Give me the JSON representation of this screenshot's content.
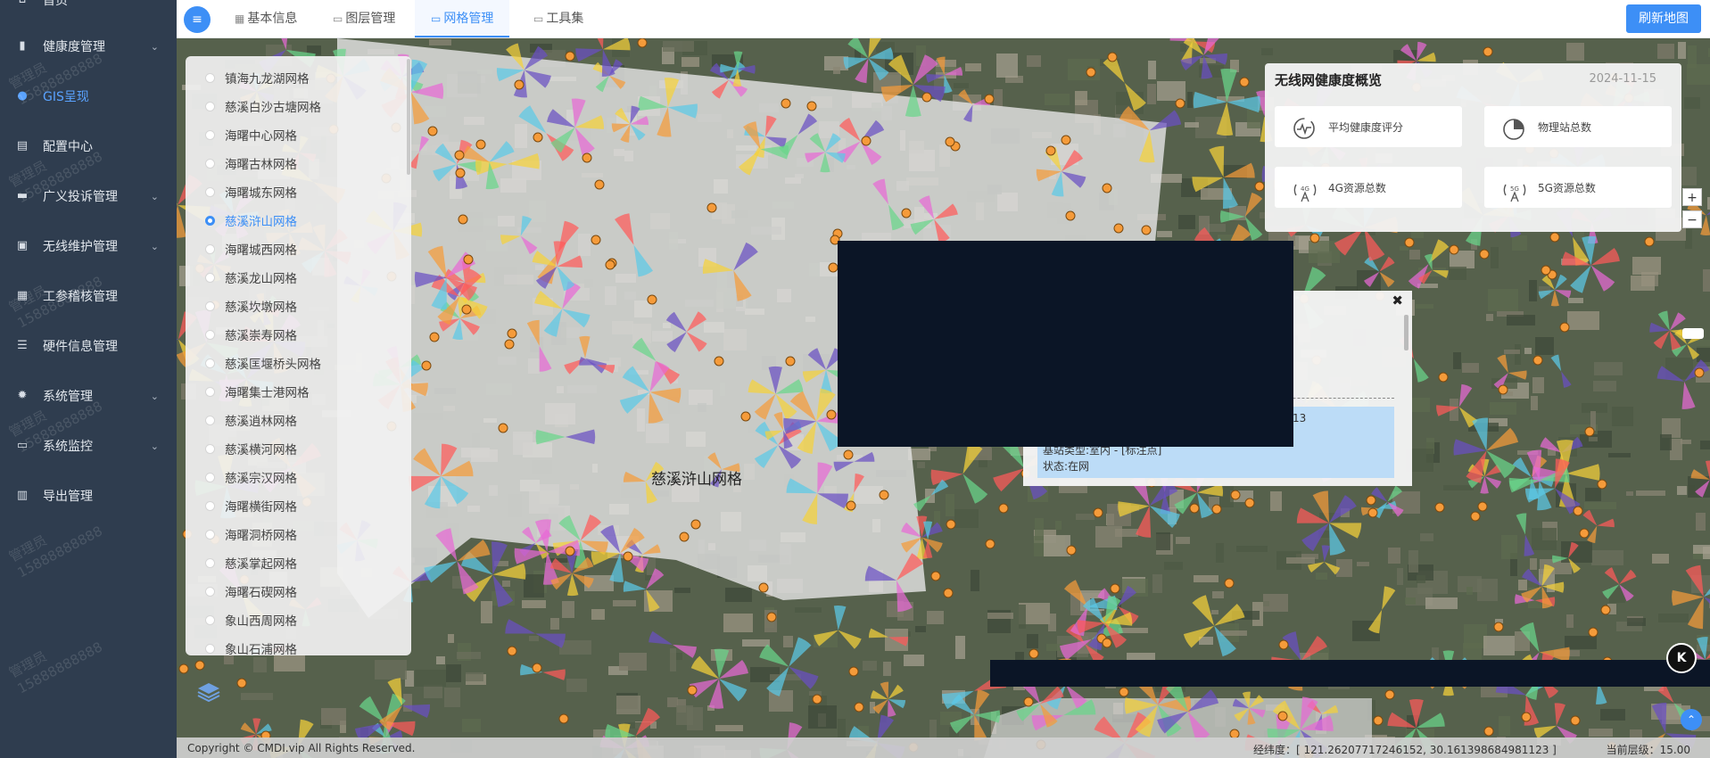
{
  "sidebar": {
    "items": [
      {
        "label": "首页",
        "icon": "home-icon",
        "chevron": false,
        "active": false
      },
      {
        "label": "健康度管理",
        "icon": "bar-chart-icon",
        "chevron": true,
        "active": false
      },
      {
        "label": "GIS呈现",
        "icon": "globe-icon",
        "chevron": false,
        "active": true
      },
      {
        "label": "配置中心",
        "icon": "config-icon",
        "chevron": false,
        "active": false
      },
      {
        "label": "广义投诉管理",
        "icon": "message-icon",
        "chevron": true,
        "active": false
      },
      {
        "label": "无线维护管理",
        "icon": "toolbox-icon",
        "chevron": true,
        "active": false
      },
      {
        "label": "工参稽核管理",
        "icon": "grid-table-icon",
        "chevron": false,
        "active": false
      },
      {
        "label": "硬件信息管理",
        "icon": "list-icon",
        "chevron": false,
        "active": false
      },
      {
        "label": "系统管理",
        "icon": "gear-icon",
        "chevron": true,
        "active": false
      },
      {
        "label": "系统监控",
        "icon": "monitor-icon",
        "chevron": true,
        "active": false
      },
      {
        "label": "导出管理",
        "icon": "export-icon",
        "chevron": false,
        "active": false
      }
    ],
    "watermark_user": "管理员",
    "watermark_phone": "15888888888"
  },
  "topbar": {
    "tabs": [
      {
        "label": "基本信息",
        "icon": "grid-icon",
        "active": false
      },
      {
        "label": "图层管理",
        "icon": "folder-icon",
        "active": false
      },
      {
        "label": "网格管理",
        "icon": "folder-icon",
        "active": true
      },
      {
        "label": "工具集",
        "icon": "folder-icon",
        "active": false
      }
    ],
    "refresh_label": "刷新地图"
  },
  "grid_list": {
    "selected": "慈溪浒山网格",
    "items": [
      "镇海九龙湖网格",
      "慈溪白沙古塘网格",
      "海曙中心网格",
      "海曙古林网格",
      "海曙城东网格",
      "慈溪浒山网格",
      "海曙城西网格",
      "慈溪龙山网格",
      "慈溪坎墩网格",
      "慈溪崇寿网格",
      "慈溪匡堰桥头网格",
      "海曙集士港网格",
      "慈溪逍林网格",
      "慈溪横河网格",
      "慈溪宗汉网格",
      "海曙横街网格",
      "海曙洞桥网格",
      "慈溪掌起网格",
      "海曙石碶网格",
      "象山西周网格",
      "象山石浦网格"
    ]
  },
  "map": {
    "grid_label": "慈溪浒山网格"
  },
  "health": {
    "title": "无线网健康度概览",
    "date": "2024-11-15",
    "cards": [
      {
        "label": "平均健康度评分",
        "icon": "pulse-icon"
      },
      {
        "label": "物理站总数",
        "icon": "pie-icon"
      },
      {
        "label": "4G资源总数",
        "icon": "antenna-4g-icon"
      },
      {
        "label": "5G资源总数",
        "icon": "antenna-5g-icon"
      }
    ]
  },
  "zoom": {
    "in": "+",
    "out": "−"
  },
  "popup": {
    "close": "✖",
    "id_suffix": "-113",
    "type": "基站类型:室内 - [标注点]",
    "status": "状态:在网"
  },
  "footer": {
    "copyright": "Copyright © CMDI.vip All Rights Reserved.",
    "coords": "经纬度：[ 121.26207717246152, 30.161398684981123 ]",
    "zoom_level": "当前层级：15.00"
  },
  "colors": {
    "accent": "#3d8ff6",
    "sidebar_bg": "#2f3d4f"
  }
}
